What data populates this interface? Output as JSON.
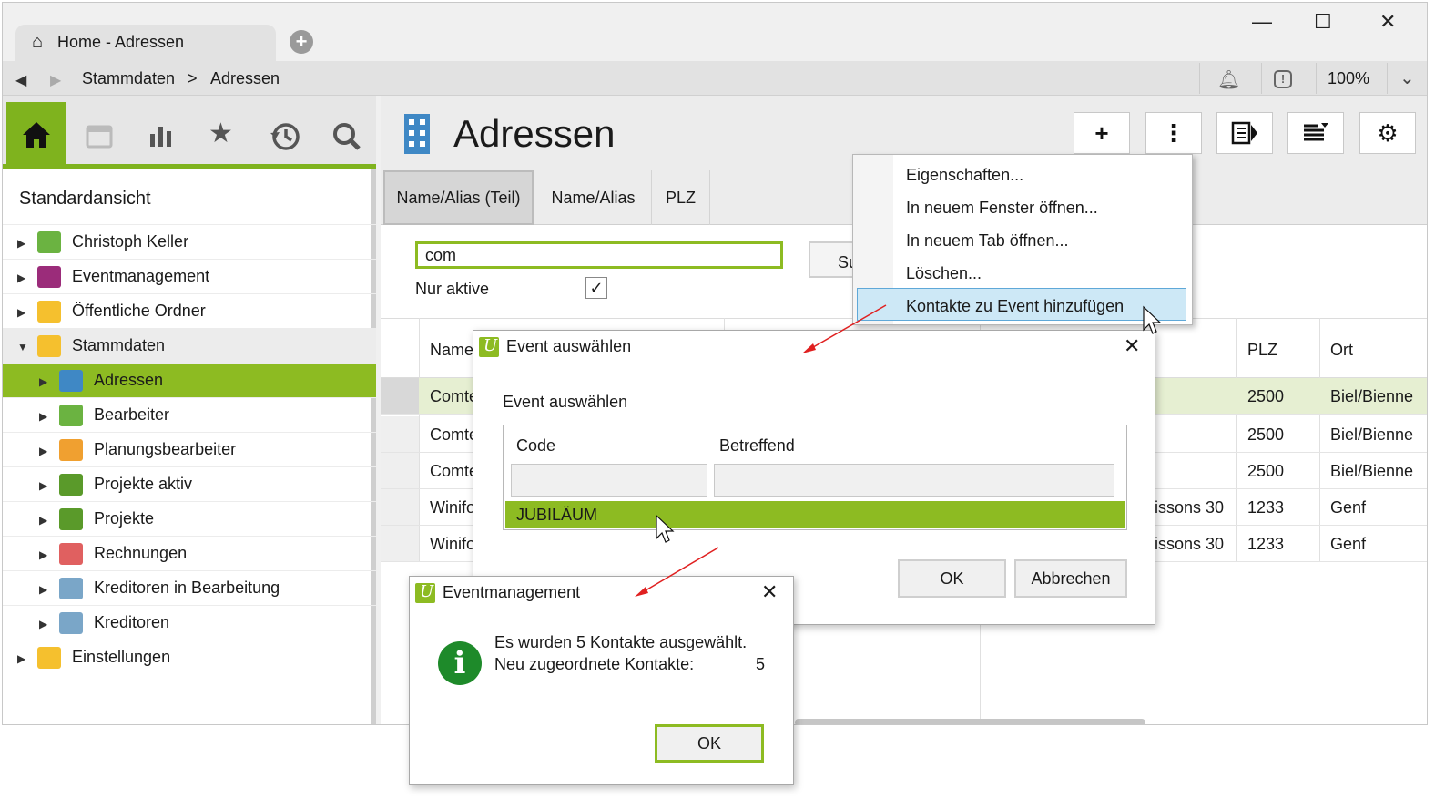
{
  "window": {
    "tab_label": "Home - Adressen",
    "minimize": "—",
    "maximize": "☐",
    "close": "✕"
  },
  "addressbar": {
    "crumb1": "Stammdaten",
    "sep": ">",
    "crumb2": "Adressen",
    "zoom": "100%"
  },
  "sidebar": {
    "view_title": "Standardansicht",
    "items": [
      {
        "label": "Christoph Keller",
        "level": 0,
        "icon": "user-icon",
        "color": "#6bb341"
      },
      {
        "label": "Eventmanagement",
        "level": 0,
        "icon": "event-icon",
        "color": "#9b2c7a"
      },
      {
        "label": "Öffentliche Ordner",
        "level": 0,
        "icon": "folder-icon",
        "color": "#f5c02e"
      },
      {
        "label": "Stammdaten",
        "level": 0,
        "icon": "folder-icon",
        "color": "#f5c02e"
      },
      {
        "label": "Adressen",
        "level": 1,
        "icon": "building-icon",
        "color": "#3f88c5"
      },
      {
        "label": "Bearbeiter",
        "level": 1,
        "icon": "user-icon",
        "color": "#6bb341"
      },
      {
        "label": "Planungsbearbeiter",
        "level": 1,
        "icon": "user-icon",
        "color": "#f0a030"
      },
      {
        "label": "Projekte aktiv",
        "level": 1,
        "icon": "project-icon",
        "color": "#5a9a2a"
      },
      {
        "label": "Projekte",
        "level": 1,
        "icon": "project-icon",
        "color": "#5a9a2a"
      },
      {
        "label": "Rechnungen",
        "level": 1,
        "icon": "invoice-icon",
        "color": "#e06060"
      },
      {
        "label": "Kreditoren in Bearbeitung",
        "level": 1,
        "icon": "creditor-icon",
        "color": "#7aa6c8"
      },
      {
        "label": "Kreditoren",
        "level": 1,
        "icon": "creditor-icon",
        "color": "#7aa6c8"
      },
      {
        "label": "Einstellungen",
        "level": 0,
        "icon": "settings-folder-icon",
        "color": "#f5c02e"
      }
    ]
  },
  "main": {
    "title": "Adressen",
    "tabs": [
      "Name/Alias (Teil)",
      "Name/Alias",
      "PLZ"
    ],
    "search_value": "com",
    "search_button": "Su",
    "only_active_label": "Nur aktive",
    "columns": {
      "name": "Name",
      "plz": "PLZ",
      "ort": "Ort"
    },
    "rows": [
      {
        "name": "Comte",
        "street": "",
        "plz": "2500",
        "ort": "Biel/Bienne"
      },
      {
        "name": "Comte",
        "street": "",
        "plz": "2500",
        "ort": "Biel/Bienne"
      },
      {
        "name": "Comte",
        "street": "",
        "plz": "2500",
        "ort": "Biel/Bienne"
      },
      {
        "name": "Winifo",
        "street": "issons 30",
        "plz": "1233",
        "ort": "Genf"
      },
      {
        "name": "Winifo",
        "street": "issons 30",
        "plz": "1233",
        "ort": "Genf"
      }
    ]
  },
  "context_menu": {
    "items": [
      "Eigenschaften...",
      "In neuem Fenster öffnen...",
      "In neuem Tab öffnen...",
      "Löschen...",
      "Kontakte zu Event hinzufügen"
    ]
  },
  "event_dialog": {
    "title": "Event auswählen",
    "heading": "Event auswählen",
    "col_code": "Code",
    "col_subject": "Betreffend",
    "selected_row": "JUBILÄUM",
    "ok": "OK",
    "cancel": "Abbrechen"
  },
  "info_dialog": {
    "title": "Eventmanagement",
    "line1": "Es wurden 5 Kontakte ausgewählt.",
    "line2": "Neu zugeordnete Kontakte:",
    "count": "5",
    "ok": "OK"
  },
  "colors": {
    "accent": "#8dbb22",
    "highlight_row": "#e6efd2",
    "menu_highlight": "#cde8f6"
  }
}
